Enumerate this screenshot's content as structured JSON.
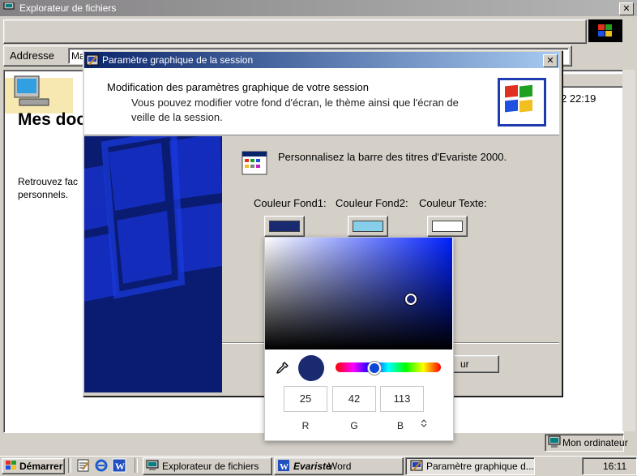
{
  "explorer": {
    "title": "Explorateur de fichiers",
    "address_label": "Addresse",
    "address_value": "Ma",
    "folder_title": "Mes documents",
    "folder_description": "Retrouvez fac personnels.",
    "column_date": "2 22:19",
    "status_location": "Mon ordinateur"
  },
  "dialog": {
    "title": "Paramètre graphique de la session",
    "header_title": "Modification des paramètres graphique de votre session",
    "header_subtitle": "Vous pouvez modifier votre fond d'écran, le thème ainsi que l'écran de veille de la session.",
    "customize_text": "Personnalisez la barre des titres d'Evariste 2000.",
    "labels": {
      "fond1": "Couleur Fond1:",
      "fond2": "Couleur Fond2:",
      "texte": "Couleur Texte:"
    },
    "swatches": {
      "fond1": "#1a2a70",
      "fond2": "#87ceeb",
      "texte": "#ffffff"
    },
    "partial_button": "ur"
  },
  "color_picker": {
    "r": "25",
    "g": "42",
    "b": "113",
    "label_r": "R",
    "label_g": "G",
    "label_b": "B",
    "toggle": "⌃⌄",
    "preview_color": "#192a71"
  },
  "taskbar": {
    "start": "Démarrer",
    "tasks": [
      {
        "label": "Explorateur de fichiers",
        "icon": "explorer-icon"
      },
      {
        "label_prefix": "Evariste",
        "label": " Word",
        "icon": "word-icon"
      },
      {
        "label": "Paramètre graphique d...",
        "icon": "settings-icon"
      }
    ],
    "clock": "16:11"
  }
}
